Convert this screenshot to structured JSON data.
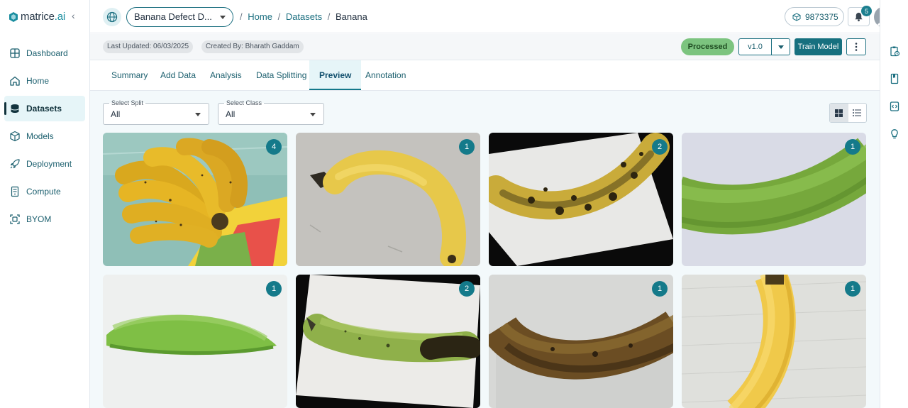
{
  "app": {
    "brand_prefix": "matrice",
    "brand_suffix": ".ai"
  },
  "sidebar": {
    "items": [
      {
        "label": "Dashboard",
        "icon": "grid-icon"
      },
      {
        "label": "Home",
        "icon": "home-icon"
      },
      {
        "label": "Datasets",
        "icon": "database-icon",
        "active": true
      },
      {
        "label": "Models",
        "icon": "cube-icon"
      },
      {
        "label": "Deployment",
        "icon": "rocket-icon"
      },
      {
        "label": "Compute",
        "icon": "server-icon"
      },
      {
        "label": "BYOM",
        "icon": "scan-icon"
      }
    ]
  },
  "header": {
    "project_name": "Banana Defect D...",
    "breadcrumb": [
      "Home",
      "Datasets",
      "Banana"
    ],
    "credits": "9873375",
    "notification_count": "5"
  },
  "infobar": {
    "last_updated": "Last Updated: 06/03/2025",
    "created_by": "Created By: Bharath Gaddam",
    "status": "Processed",
    "version": "v1.0",
    "train_label": "Train Model"
  },
  "tabs": [
    {
      "label": "Summary"
    },
    {
      "label": "Add Data"
    },
    {
      "label": "Analysis"
    },
    {
      "label": "Data Splitting"
    },
    {
      "label": "Preview",
      "active": true
    },
    {
      "label": "Annotation"
    }
  ],
  "filters": {
    "split_label": "Select Split",
    "split_value": "All",
    "class_label": "Select Class",
    "class_value": "All"
  },
  "images": [
    {
      "count": "4",
      "description": "bunch of ripe bananas"
    },
    {
      "count": "1",
      "description": "single ripe banana"
    },
    {
      "count": "2",
      "description": "overripe spotted banana"
    },
    {
      "count": "1",
      "description": "green banana close-up"
    },
    {
      "count": "1",
      "description": "green banana"
    },
    {
      "count": "2",
      "description": "green banana with dark tip"
    },
    {
      "count": "1",
      "description": "dark rotting banana"
    },
    {
      "count": "1",
      "description": "yellow banana close-up"
    }
  ],
  "colors": {
    "accent": "#147a8a",
    "status_green": "#7cc47f",
    "sidebar_active_bg": "#e6f5f8"
  }
}
